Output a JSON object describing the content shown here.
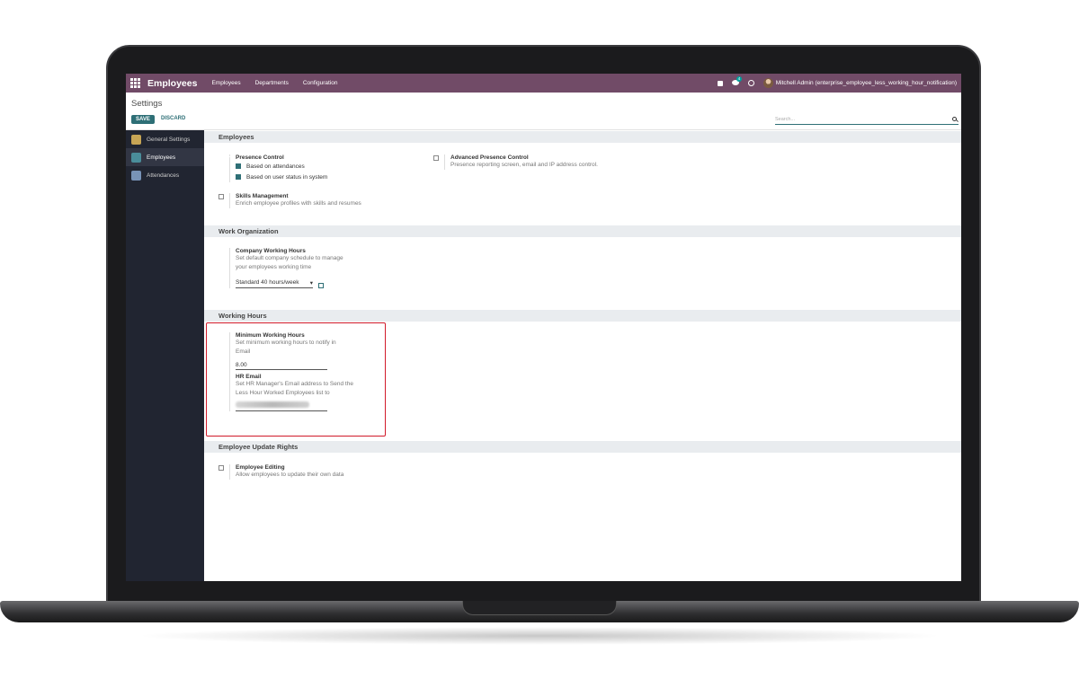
{
  "topbar": {
    "brand": "Employees",
    "nav": [
      "Employees",
      "Departments",
      "Configuration"
    ],
    "chat_count": "4",
    "user": "Mitchell Admin (enterprise_employee_less_working_hour_notification)"
  },
  "control": {
    "title": "Settings",
    "save": "SAVE",
    "discard": "DISCARD",
    "search_placeholder": "Search..."
  },
  "sidebar": {
    "items": [
      "General Settings",
      "Employees",
      "Attendances"
    ]
  },
  "sections": {
    "employees": {
      "title": "Employees",
      "presence_label": "Presence Control",
      "presence_opt1": "Based on attendances",
      "presence_opt2": "Based on user status in system",
      "adv_label": "Advanced Presence Control",
      "adv_desc": "Presence reporting screen, email and IP address control.",
      "skills_label": "Skills Management",
      "skills_desc": "Enrich employee profiles with skills and resumes"
    },
    "work_org": {
      "title": "Work Organization",
      "label": "Company Working Hours",
      "desc1": "Set default company schedule to manage",
      "desc2": "your employees working time",
      "value": "Standard 40 hours/week"
    },
    "working_hours": {
      "title": "Working Hours",
      "min_label": "Minimum Working Hours",
      "min_desc1": "Set minimum working hours to notify in",
      "min_desc2": "Email",
      "min_value": "8.00",
      "hr_label": "HR Email",
      "hr_desc1": "Set HR Manager's Email address to Send the",
      "hr_desc2": "Less Hour Worked Employees list to"
    },
    "update_rights": {
      "title": "Employee Update Rights",
      "label": "Employee Editing",
      "desc": "Allow employees to update their own data"
    }
  },
  "colors": {
    "topbar": "#714b67",
    "accent": "#2e6f76",
    "sidebar": "#212531",
    "highlight": "#d11a2a"
  }
}
